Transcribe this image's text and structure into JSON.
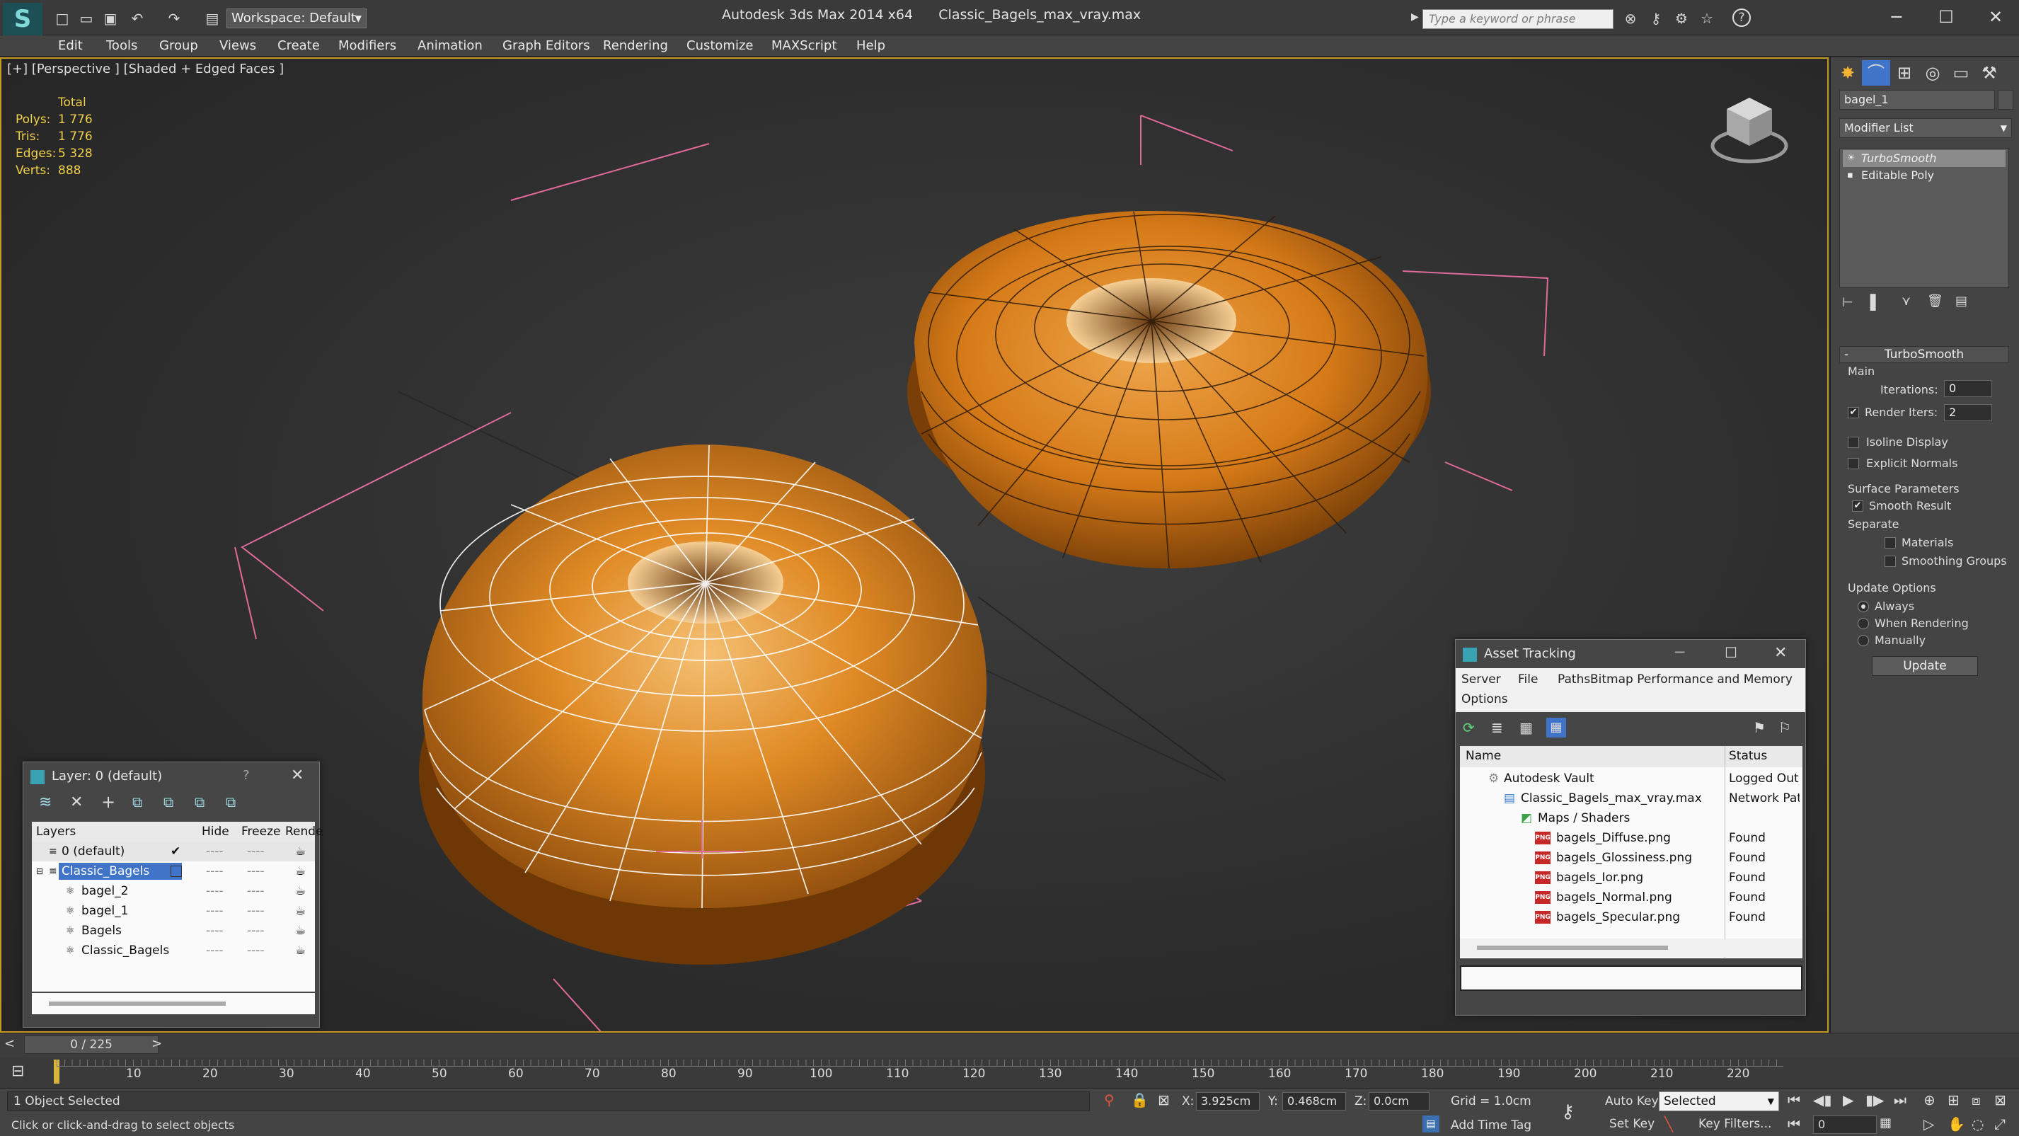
{
  "title_bar": {
    "app_title": "Autodesk 3ds Max  2014 x64",
    "file_name": "Classic_Bagels_max_vray.max",
    "workspace_label": "Workspace: Default",
    "search_placeholder": "Type a keyword or phrase",
    "minimize": "─",
    "maximize": "☐",
    "close": "✕"
  },
  "menu": [
    "Edit",
    "Tools",
    "Group",
    "Views",
    "Create",
    "Modifiers",
    "Animation",
    "Graph Editors",
    "Rendering",
    "Customize",
    "MAXScript",
    "Help"
  ],
  "viewport": {
    "label": "[+] [Perspective ] [Shaded + Edged Faces ]",
    "stats": {
      "header": "Total",
      "rows": [
        {
          "k": "Polys:",
          "v": "1 776"
        },
        {
          "k": "Tris:",
          "v": "1 776"
        },
        {
          "k": "Edges:",
          "v": "5 328"
        },
        {
          "k": "Verts:",
          "v": "888"
        }
      ]
    }
  },
  "command_panel": {
    "object_name": "bagel_1",
    "modifier_list": "Modifier List",
    "stack": [
      "TurboSmooth",
      "Editable Poly"
    ],
    "rollout_title": "TurboSmooth",
    "main_label": "Main",
    "iterations_label": "Iterations:",
    "iterations_value": "0",
    "render_iters_label": "Render Iters:",
    "render_iters_value": "2",
    "isoline_label": "Isoline Display",
    "explicit_normals_label": "Explicit Normals",
    "surface_params_label": "Surface Parameters",
    "smooth_result_label": "Smooth Result",
    "separate_label": "Separate",
    "materials_label": "Materials",
    "smoothing_groups_label": "Smoothing Groups",
    "update_options_label": "Update Options",
    "always_label": "Always",
    "when_rendering_label": "When Rendering",
    "manually_label": "Manually",
    "update_button": "Update"
  },
  "layer_dialog": {
    "title": "Layer: 0 (default)",
    "help": "?",
    "close": "✕",
    "columns": [
      "Layers",
      "Hide",
      "Freeze",
      "Rende"
    ],
    "rows": [
      {
        "name": "0 (default)",
        "indent": 1
      },
      {
        "name": "Classic_Bagels",
        "indent": 1
      },
      {
        "name": "bagel_2",
        "indent": 2
      },
      {
        "name": "bagel_1",
        "indent": 2
      },
      {
        "name": "Bagels",
        "indent": 2
      },
      {
        "name": "Classic_Bagels",
        "indent": 2
      }
    ],
    "dash": "----"
  },
  "asset_dialog": {
    "title": "Asset Tracking",
    "menu": [
      "Server",
      "File",
      "Paths",
      "Bitmap Performance and Memory",
      "Options"
    ],
    "columns": [
      "Name",
      "Status"
    ],
    "rows": [
      {
        "name": "Autodesk Vault",
        "status": "Logged Out",
        "indent": 1
      },
      {
        "name": "Classic_Bagels_max_vray.max",
        "status": "Network Pat",
        "indent": 2
      },
      {
        "name": "Maps / Shaders",
        "status": "",
        "indent": 3
      },
      {
        "name": "bagels_Diffuse.png",
        "status": "Found",
        "indent": 4
      },
      {
        "name": "bagels_Glossiness.png",
        "status": "Found",
        "indent": 4
      },
      {
        "name": "bagels_Ior.png",
        "status": "Found",
        "indent": 4
      },
      {
        "name": "bagels_Normal.png",
        "status": "Found",
        "indent": 4
      },
      {
        "name": "bagels_Specular.png",
        "status": "Found",
        "indent": 4
      }
    ],
    "png_badge": "PNG"
  },
  "timeline": {
    "frame_display": "0 / 225",
    "ticks": [
      "10",
      "20",
      "30",
      "40",
      "50",
      "60",
      "70",
      "80",
      "90",
      "100",
      "110",
      "120",
      "130",
      "140",
      "150",
      "160",
      "170",
      "180",
      "190",
      "200",
      "210",
      "220"
    ]
  },
  "status_bar": {
    "selection": "1 Object Selected",
    "prompt": "Click or click-and-drag to select objects",
    "x_label": "X:",
    "x_value": "3.925cm",
    "y_label": "Y:",
    "y_value": "0.468cm",
    "z_label": "Z:",
    "z_value": "0.0cm",
    "grid": "Grid = 1.0cm",
    "add_time_tag": "Add Time Tag",
    "auto_key": "Auto Key",
    "set_key": "Set Key",
    "selected": "Selected",
    "key_filters": "Key Filters...",
    "frame": "0"
  },
  "colors": {
    "viewport_border": "#c49a23",
    "stats_text": "#f2d14a",
    "selection_blue": "#3f74c8",
    "bagel_orange": "#d9821e",
    "bbox_pink": "#e06a9a"
  }
}
